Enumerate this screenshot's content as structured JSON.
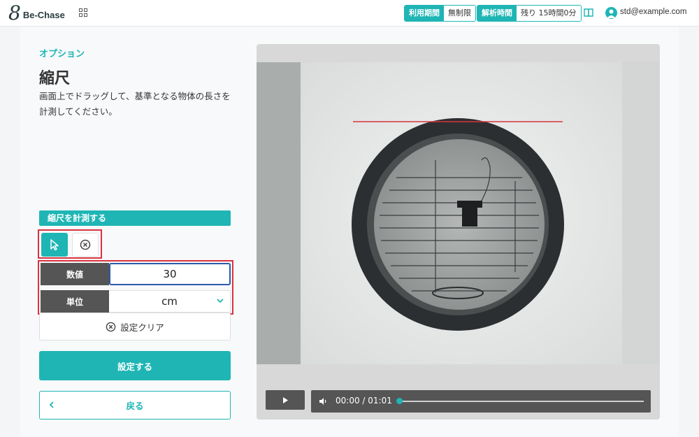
{
  "header": {
    "brand": "Be-Chase",
    "usage_period_label": "利用期間",
    "usage_period_value": "無制限",
    "analysis_time_label": "解析時間",
    "analysis_time_value": "残り 15時間0分",
    "user_email": "std@example.com"
  },
  "panel": {
    "section": "オプション",
    "title": "縮尺",
    "description": "画面上でドラッグして、基準となる物体の長さを計測してください。",
    "measure_heading": "縮尺を計測する",
    "value_label": "数値",
    "value": "30",
    "unit_label": "単位",
    "unit": "cm",
    "clear_label": "設定クリア",
    "submit_label": "設定する",
    "back_label": "戻る"
  },
  "player": {
    "time": "00:00 / 01:01",
    "progress": 0
  },
  "colors": {
    "accent": "#1fb5b5",
    "highlight": "#d9333f",
    "measure_line": "#d9333f"
  }
}
